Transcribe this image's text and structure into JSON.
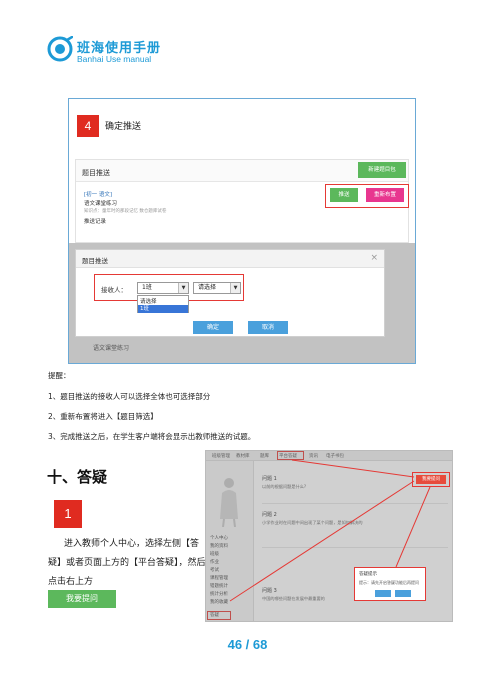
{
  "header": {
    "logo_title": "班海使用手册",
    "logo_subtitle": "Banhai Use manual",
    "brand_color": "#1d9ad6"
  },
  "screenshot1": {
    "step_number": "4",
    "step_title": "确定推送",
    "panel_title": "题目推送",
    "new_package_button": "新建题目包",
    "question_title": "[初一 语文]",
    "question_subtitle": "语文课堂练习",
    "question_meta": "知识点：童年时的那段记忆  数仓题库试卷",
    "push_history": "推送记录",
    "push_button": "推送",
    "republish_button": "重新布置",
    "dialog_title": "题目推送",
    "dialog_close": "×",
    "receiver_label": "接收人：",
    "class_select": "1班",
    "student_select": "请选择",
    "dropdown_options": [
      "请选择",
      "1班"
    ],
    "confirm_button": "确定",
    "cancel_button": "取消",
    "under_text": "语文课堂练习"
  },
  "notes": {
    "heading": "提醒：",
    "items": [
      "1、题目推送的接收人可以选择全体也可选择部分",
      "2、重新布置将进入【题目筛选】",
      "3、完成推送之后，在学生客户端将会显示出教师推送的试题。"
    ]
  },
  "section": {
    "heading": "十、答疑",
    "step_number": "1",
    "paragraph_lines": [
      "进入教师个人中心，选择左侧【答",
      "疑】或者页面上方的【平台答疑】，然后",
      "点击右上方"
    ],
    "ask_button": "我要提问"
  },
  "screenshot2": {
    "tabs": [
      "班级管理",
      "教材库",
      "题库",
      "平台答疑",
      "资讯",
      "电子书包"
    ],
    "side_menu": [
      "个人中心",
      "我的资料",
      "班级",
      "作业",
      "考试",
      "课程管理",
      "错题统计",
      "统计分析",
      "我的收藏",
      "答疑"
    ],
    "ask_button": "我要提问",
    "questions": [
      {
        "title": "问题 1",
        "text": "以前的根据问题是什么?"
      },
      {
        "title": "问题 2",
        "text": "小学作业时在问题中间出现了某个问题，是如何解决的"
      },
      {
        "title": "问题 3",
        "text": "中国的哪些问题在发展中最重要的"
      }
    ],
    "dialog_title": "答疑提示",
    "dialog_text": "提示：请先开启答疑功能后再提问"
  },
  "page": {
    "number": "46 / 68"
  }
}
